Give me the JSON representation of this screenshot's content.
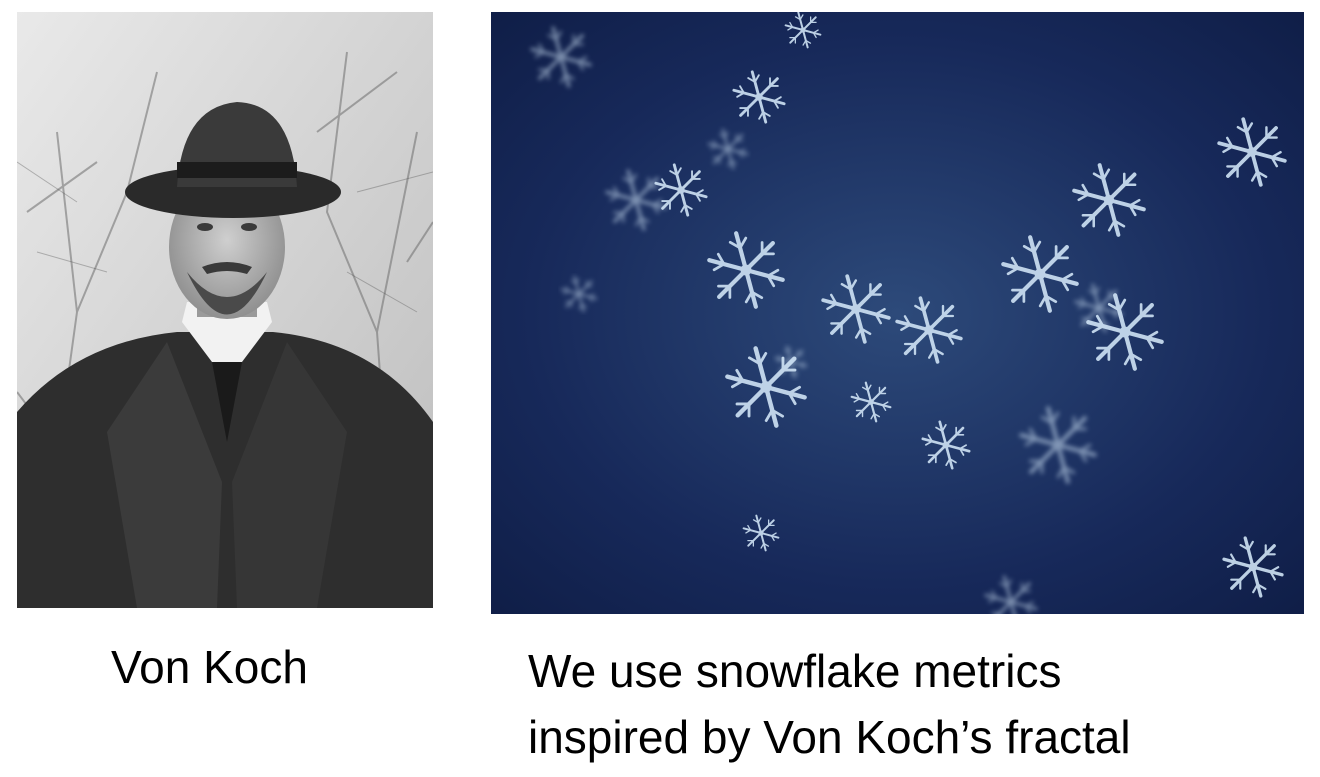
{
  "left_caption": "Von Koch",
  "right_caption": {
    "line1": "We use snowflake metrics",
    "line2": "inspired by Von Koch’s fractal"
  },
  "portrait": {
    "icon": "person-portrait-icon"
  },
  "snowflake_photo": {
    "icon": "snowflake-icon",
    "background_color": "#13234a",
    "flake_color": "#cfe3f5"
  }
}
